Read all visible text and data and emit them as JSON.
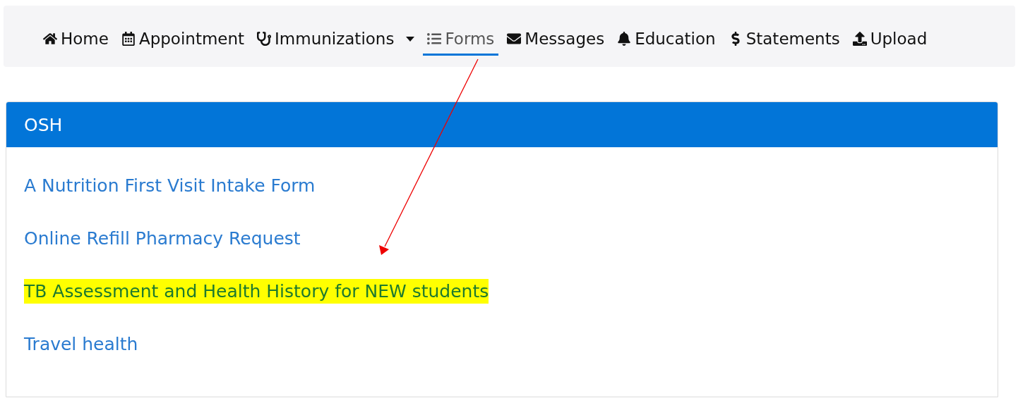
{
  "nav": [
    {
      "label": "Home",
      "selected": false
    },
    {
      "label": "Appointment",
      "selected": false
    },
    {
      "label": "Immunizations",
      "selected": false,
      "dropdown": true
    },
    {
      "label": "Forms",
      "selected": true
    },
    {
      "label": "Messages",
      "selected": false
    },
    {
      "label": "Education",
      "selected": false
    },
    {
      "label": "Statements",
      "selected": false
    },
    {
      "label": "Upload",
      "selected": false
    }
  ],
  "panel": {
    "title": "OSH",
    "links": [
      {
        "label": "A Nutrition First Visit Intake Form",
        "highlighted": false
      },
      {
        "label": "Online Refill Pharmacy Request",
        "highlighted": false
      },
      {
        "label": "TB Assessment and Health History for NEW students",
        "highlighted": true
      },
      {
        "label": "Travel health",
        "highlighted": false
      }
    ]
  },
  "annotation": {
    "kind": "arrow"
  }
}
